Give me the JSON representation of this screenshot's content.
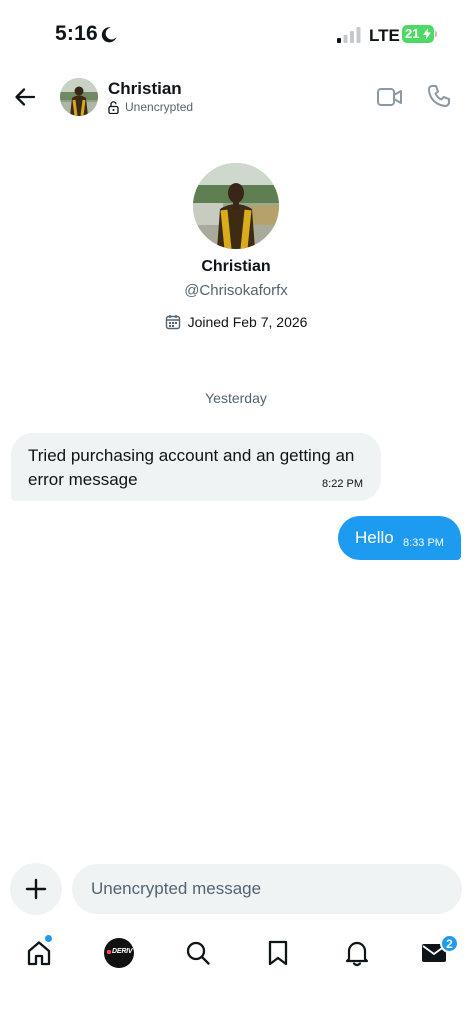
{
  "status_bar": {
    "time": "5:16",
    "network": "LTE",
    "battery": "21"
  },
  "header": {
    "name": "Christian",
    "encryption_status": "Unencrypted"
  },
  "profile": {
    "name": "Christian",
    "handle": "@Chrisokaforfx",
    "joined": "Joined Feb 7, 2026"
  },
  "conversation": {
    "day_separator": "Yesterday",
    "messages": [
      {
        "direction": "incoming",
        "text": "Tried purchasing account and an getting an error message",
        "time": "8:22 PM"
      },
      {
        "direction": "outgoing",
        "text": "Hello",
        "time": "8:33 PM"
      }
    ]
  },
  "composer": {
    "placeholder": "Unencrypted message"
  },
  "bottom_nav": {
    "items": [
      "home-icon",
      "deriv-app-icon",
      "search-icon",
      "bookmark-icon",
      "bell-icon",
      "mail-icon"
    ],
    "deriv_label": "DERIV",
    "messages_badge": "2"
  },
  "colors": {
    "accent": "#1d9bf0",
    "bubble_incoming": "#eff3f4",
    "secondary_text": "#536471"
  }
}
